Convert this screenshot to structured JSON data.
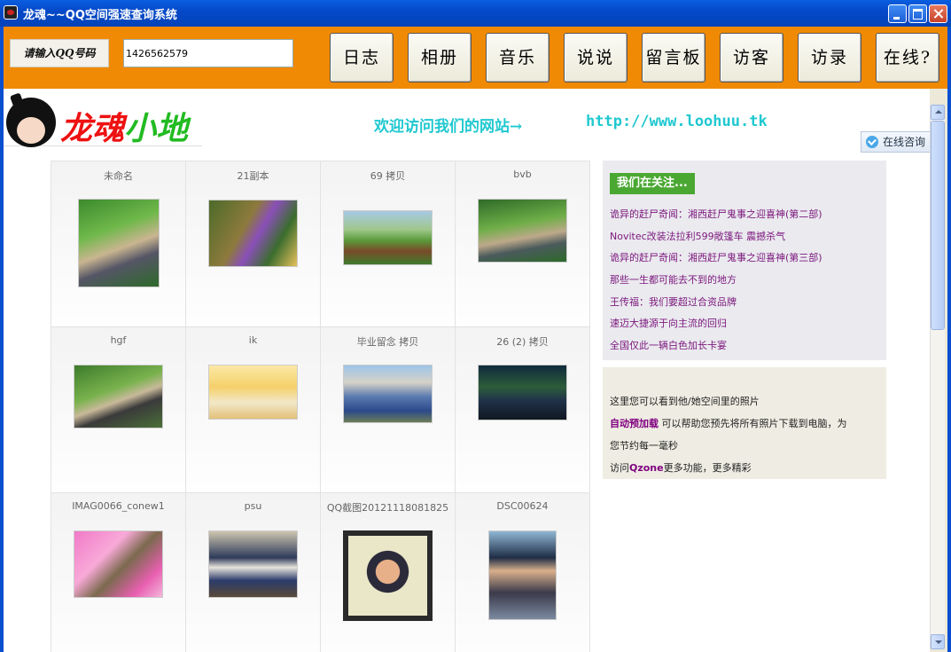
{
  "window": {
    "title": "龙魂~~QQ空间强速查询系统"
  },
  "toolbar": {
    "qq_label": "请输入QQ号码",
    "qq_value": "1426562579",
    "buttons": [
      "日志",
      "相册",
      "音乐",
      "说说",
      "留言板",
      "访客",
      "访录",
      "在线?"
    ]
  },
  "header": {
    "logo_text": [
      "龙",
      "魂",
      "小",
      "地"
    ],
    "welcome": "欢迎访问我们的网站→",
    "url": "http://www.loohuu.tk",
    "online_consult": "在线咨询"
  },
  "albums": [
    {
      "title": "未命名",
      "icon": "photo-thumb"
    },
    {
      "title": "21副本",
      "icon": "photo-thumb"
    },
    {
      "title": "69 拷贝",
      "icon": "photo-thumb"
    },
    {
      "title": "bvb",
      "icon": "photo-thumb"
    },
    {
      "title": "hgf",
      "icon": "photo-thumb"
    },
    {
      "title": "ik",
      "icon": "photo-thumb"
    },
    {
      "title": "毕业留念 拷贝",
      "icon": "photo-thumb"
    },
    {
      "title": "26 (2) 拷贝",
      "icon": "photo-thumb"
    },
    {
      "title": "IMAG0066_conew1",
      "icon": "photo-thumb"
    },
    {
      "title": "psu",
      "icon": "photo-thumb"
    },
    {
      "title": "QQ截图20121118081825",
      "icon": "photo-thumb"
    },
    {
      "title": "DSC00624",
      "icon": "photo-thumb"
    }
  ],
  "follow": {
    "heading": "我们在关注...",
    "items": [
      "诡异的赶尸奇闻：湘西赶尸鬼事之迎喜神(第二部)",
      "Novitec改装法拉利599敞篷车 震撼杀气",
      "诡异的赶尸奇闻：湘西赶尸鬼事之迎喜神(第三部)",
      "那些一生都可能去不到的地方",
      "王传福：我们要超过合资品牌",
      "速迈大捷源于向主流的回归",
      "全国仅此一辆白色加长卡宴"
    ]
  },
  "info": {
    "line1": "这里您可以看到他/她空间里的照片",
    "preload": "自动预加载",
    "line2_rest": " 可以帮助您预先将所有照片下载到电脑，为",
    "line3": "您节约每一毫秒",
    "visit_prefix": "访问",
    "qzone": "Qzone",
    "visit_suffix": "更多功能，更多精彩"
  },
  "colors": {
    "toolbar_bg": "#f08a05",
    "title_bar": "#0549c9",
    "accent_cyan": "#20c8d0",
    "follow_green": "#4aa832",
    "link_purple": "#800080"
  }
}
